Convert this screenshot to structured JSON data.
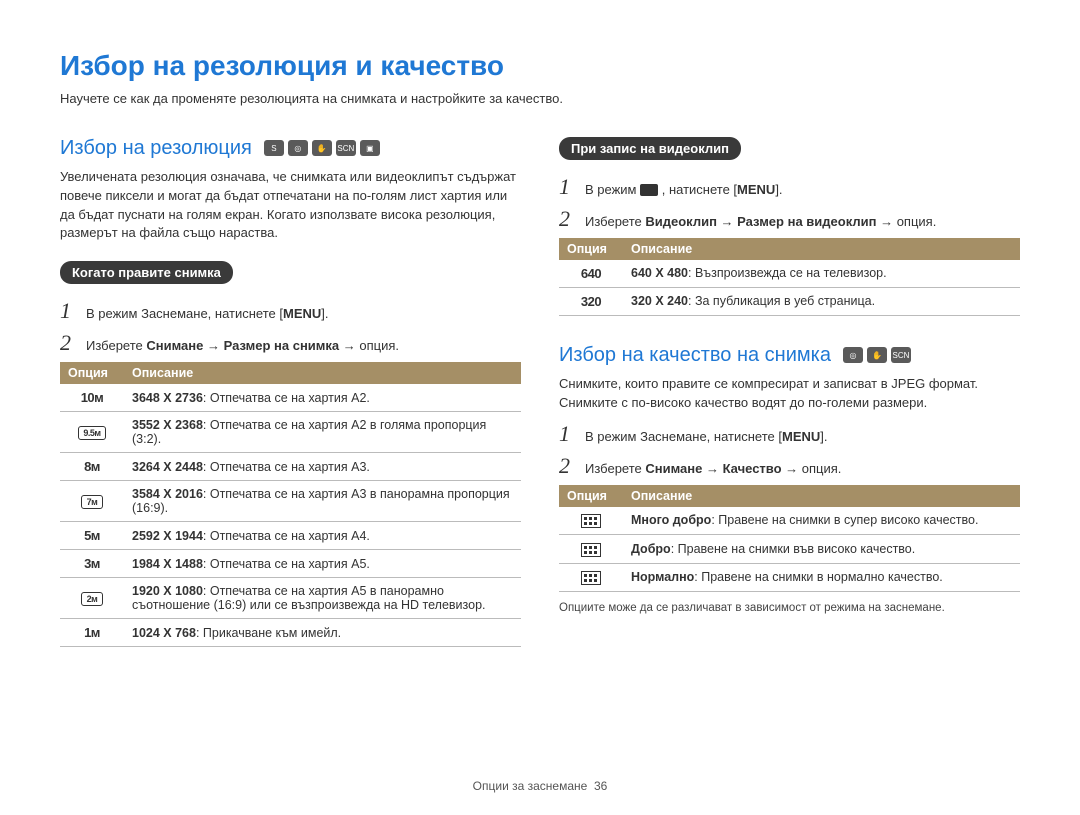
{
  "title": "Избор на резолюция и качество",
  "subtitle": "Научете се как да променяте резолюцията на снимката и настройките за качество.",
  "left": {
    "heading": "Избор на резолюция",
    "intro": "Увеличената резолюция означава, че снимката или видеоклипът съдържат повече пиксели и могат да бъдат отпечатани на по-голям лист хартия или да бъдат пуснати на голям екран. Когато използвате висока резолюция, размерът на файла също нараства.",
    "photo_label": "Когато правите снимка",
    "photo_step1_pre": "В режим Заснемане, натиснете [",
    "photo_step1_btn": "MENU",
    "photo_step1_post": "].",
    "photo_step2_pre": "Изберете ",
    "photo_step2_bold": "Снимане → Размер на снимка → ",
    "photo_step2_post": "опция.",
    "th_option": "Опция",
    "th_desc": "Описание",
    "photo_rows": [
      {
        "opt": "10m",
        "desc_b": "3648 X 2736",
        "desc": ": Отпечатва се на хартия А2."
      },
      {
        "opt": "9.5m_box",
        "desc_b": "3552 X 2368",
        "desc": ": Отпечатва се на хартия A2 в голяма пропорция (3:2)."
      },
      {
        "opt": "8m",
        "desc_b": "3264 X 2448",
        "desc": ": Отпечатва се на хартия A3."
      },
      {
        "opt": "7m_box",
        "desc_b": "3584 X 2016",
        "desc": ": Отпечатва се на хартия A3 в панорамна пропорция (16:9)."
      },
      {
        "opt": "5m",
        "desc_b": "2592 X 1944",
        "desc": ": Отпечатва се на хартия A4."
      },
      {
        "opt": "3m",
        "desc_b": "1984 X 1488",
        "desc": ": Отпечатва се на хартия A5."
      },
      {
        "opt": "2m_box",
        "desc_b": "1920 X 1080",
        "desc": ": Отпечатва се на хартия A5 в панорамно съотношение (16:9) или се възпроизвежда на HD телевизор."
      },
      {
        "opt": "1m",
        "desc_b": "1024 X 768",
        "desc": ": Прикачване към имейл."
      }
    ]
  },
  "right": {
    "video_label": "При запис на видеоклип",
    "video_step1_pre": "В режим ",
    "video_step1_mid": " , натиснете [",
    "video_step1_btn": "MENU",
    "video_step1_post": "].",
    "video_step2_pre": "Изберете ",
    "video_step2_bold": "Видеоклип → Размер на видеоклип → ",
    "video_step2_post": "опция.",
    "th_option": "Опция",
    "th_desc": "Описание",
    "video_rows": [
      {
        "opt": "640",
        "desc_b": "640 X 480",
        "desc": ": Възпроизвежда се на телевизор."
      },
      {
        "opt": "320",
        "desc_b": "320 X 240",
        "desc": ": За публикация в уеб страница."
      }
    ],
    "quality_heading": "Избор на качество на снимка",
    "quality_intro": "Снимките, които правите се компресират и записват в JPEG формат. Снимките с по-високо качество водят до по-големи размери.",
    "quality_step1_pre": "В режим Заснемане, натиснете [",
    "quality_step1_btn": "MENU",
    "quality_step1_post": "].",
    "quality_step2_pre": "Изберете ",
    "quality_step2_bold": "Снимане → Качество → ",
    "quality_step2_post": "опция.",
    "quality_rows": [
      {
        "desc_b": "Много добро",
        "desc": ": Правене на снимки в супер високо качество."
      },
      {
        "desc_b": "Добро",
        "desc": ": Правене на снимки във високо качество."
      },
      {
        "desc_b": "Нормално",
        "desc": ": Правене на снимки в нормално качество."
      }
    ],
    "footnote": "Опциите може да се различават в зависимост от режима на заснемане."
  },
  "footer": {
    "text": "Опции за заснемане",
    "page": "36"
  }
}
